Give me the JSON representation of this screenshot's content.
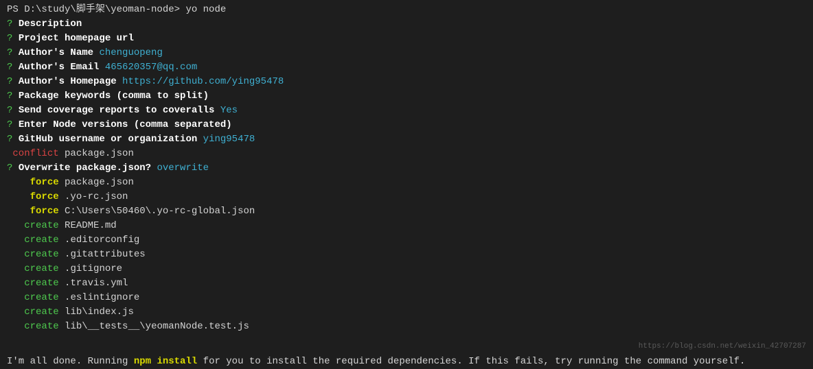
{
  "prompt": {
    "prefix": "PS D:\\study\\脚手架\\yeoman-node> ",
    "command": "yo node"
  },
  "questions": [
    {
      "q": "?",
      "label": "Description",
      "value": ""
    },
    {
      "q": "?",
      "label": "Project homepage url",
      "value": ""
    },
    {
      "q": "?",
      "label": "Author's Name",
      "value": "chenguopeng"
    },
    {
      "q": "?",
      "label": "Author's Email",
      "value": "465620357@qq.com"
    },
    {
      "q": "?",
      "label": "Author's Homepage",
      "value": "https://github.com/ying95478"
    },
    {
      "q": "?",
      "label": "Package keywords (comma to split)",
      "value": ""
    },
    {
      "q": "?",
      "label": "Send coverage reports to coveralls",
      "value": "Yes"
    },
    {
      "q": "?",
      "label": "Enter Node versions (comma separated)",
      "value": ""
    },
    {
      "q": "?",
      "label": "GitHub username or organization",
      "value": "ying95478"
    }
  ],
  "conflict": {
    "type": "conflict",
    "file": "package.json"
  },
  "overwrite": {
    "q": "?",
    "label": "Overwrite package.json?",
    "value": "overwrite"
  },
  "files": [
    {
      "action": "force",
      "file": "package.json"
    },
    {
      "action": "force",
      "file": ".yo-rc.json"
    },
    {
      "action": "force",
      "file": "C:\\Users\\50460\\.yo-rc-global.json"
    },
    {
      "action": "create",
      "file": "README.md"
    },
    {
      "action": "create",
      "file": ".editorconfig"
    },
    {
      "action": "create",
      "file": ".gitattributes"
    },
    {
      "action": "create",
      "file": ".gitignore"
    },
    {
      "action": "create",
      "file": ".travis.yml"
    },
    {
      "action": "create",
      "file": ".eslintignore"
    },
    {
      "action": "create",
      "file": "lib\\index.js"
    },
    {
      "action": "create",
      "file": "lib\\__tests__\\yeomanNode.test.js"
    }
  ],
  "done": {
    "prefix": "I'm all done. Running ",
    "command": "npm install",
    "suffix": " for you to install the required dependencies. If this fails, try running the command yourself."
  },
  "watermark": "https://blog.csdn.net/weixin_42707287"
}
